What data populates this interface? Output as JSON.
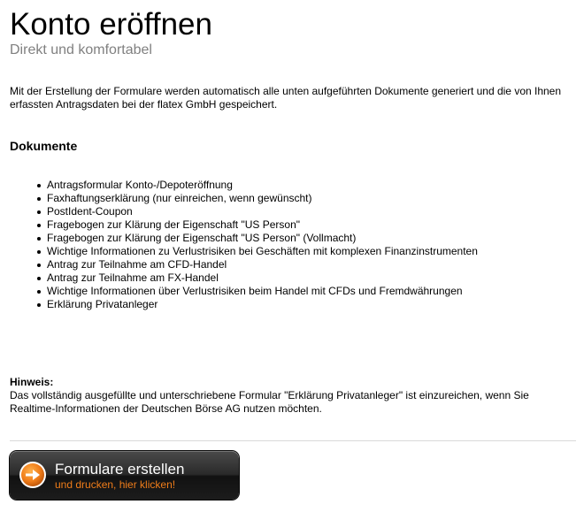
{
  "header": {
    "title": "Konto eröffnen",
    "subtitle": "Direkt und komfortabel"
  },
  "intro": "Mit der Erstellung der Formulare werden automatisch alle unten aufgeführten Dokumente generiert und die von Ihnen erfassten Antragsdaten bei der flatex GmbH gespeichert.",
  "documents": {
    "heading": "Dokumente",
    "items": [
      "Antragsformular Konto-/Depoteröffnung",
      "Faxhaftungserklärung (nur einreichen, wenn gewünscht)",
      "PostIdent-Coupon",
      "Fragebogen zur Klärung der Eigenschaft \"US Person\"",
      "Fragebogen zur Klärung der Eigenschaft \"US Person\" (Vollmacht)",
      "Wichtige Informationen zu Verlustrisiken bei Geschäften mit komplexen Finanzinstrumenten",
      "Antrag zur Teilnahme am CFD-Handel",
      "Antrag zur Teilnahme am FX-Handel",
      "Wichtige Informationen über Verlustrisiken beim Handel mit CFDs und Fremdwährungen",
      "Erklärung Privatanleger"
    ]
  },
  "hint": {
    "label": "Hinweis:",
    "text": "Das vollständig ausgefüllte und unterschriebene Formular \"Erklärung Privatanleger\" ist einzureichen, wenn Sie Realtime-Informationen der Deutschen Börse AG nutzen möchten."
  },
  "cta": {
    "label": "Formulare erstellen",
    "sublabel": "und drucken, hier klicken!",
    "icon": "arrow-right-circle-icon",
    "accent_color": "#f07d1a"
  }
}
